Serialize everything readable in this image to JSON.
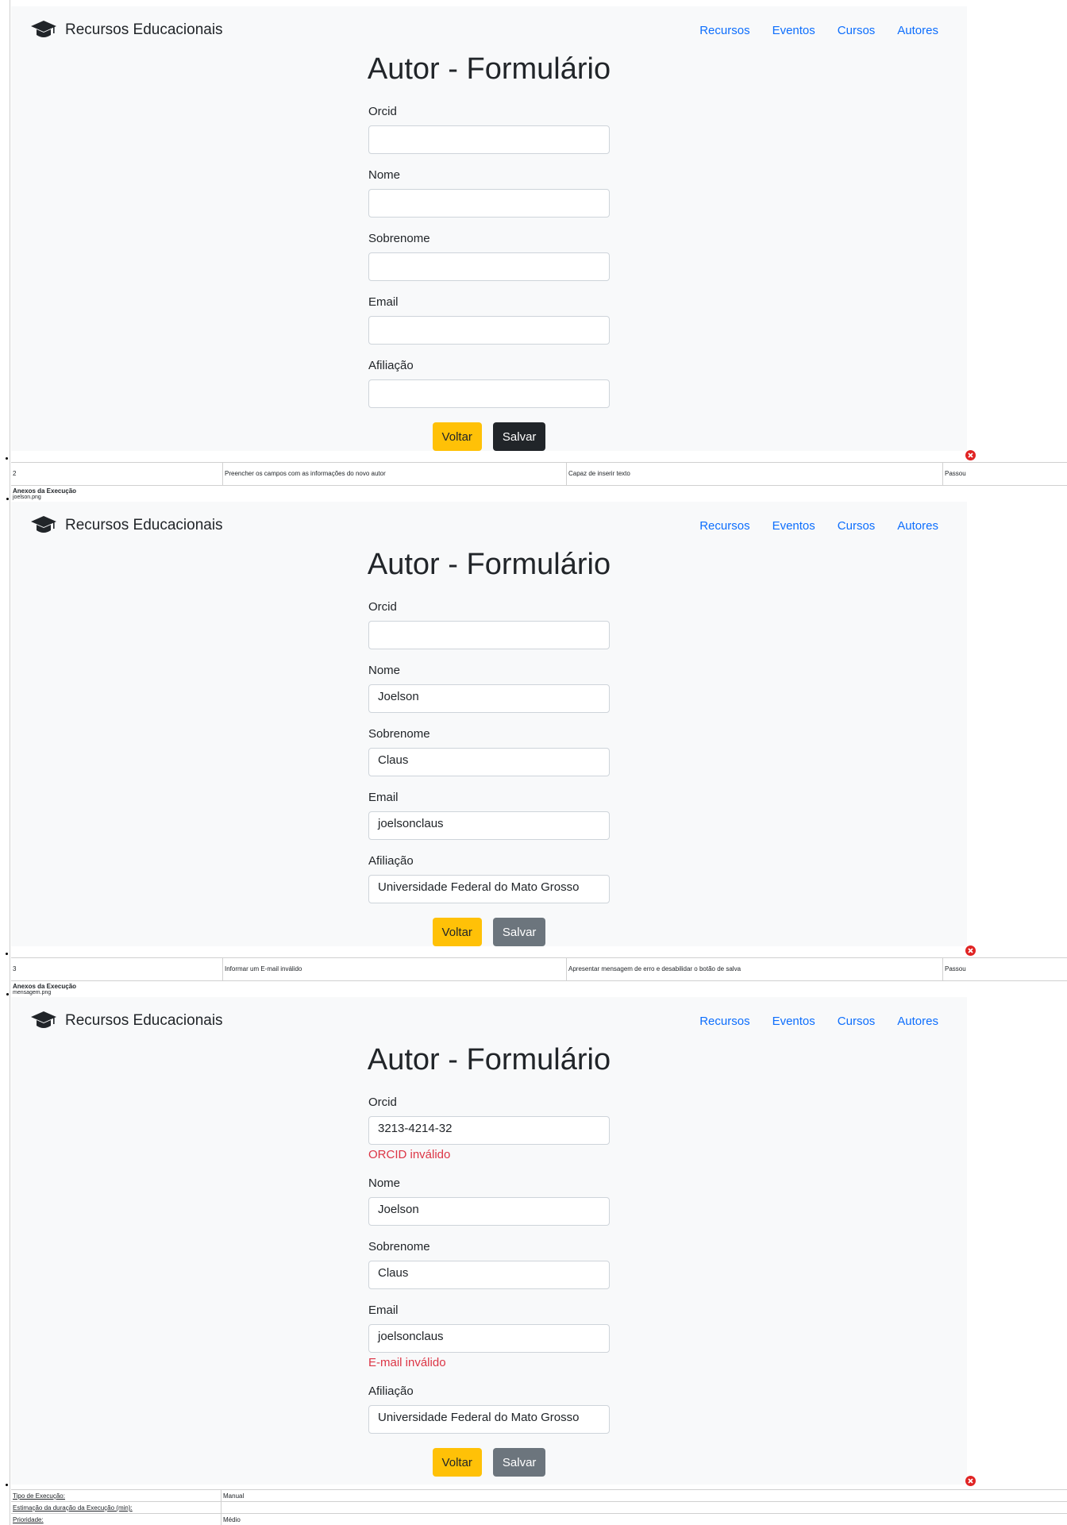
{
  "brand": {
    "name": "Recursos Educacionais",
    "icon": "graduation-cap-icon"
  },
  "nav": [
    {
      "label": "Recursos"
    },
    {
      "label": "Eventos"
    },
    {
      "label": "Cursos"
    },
    {
      "label": "Autores"
    }
  ],
  "labels": {
    "title": "Autor - Formulário",
    "orcid": "Orcid",
    "nome": "Nome",
    "sobrenome": "Sobrenome",
    "email": "Email",
    "afiliacao": "Afiliação",
    "voltar": "Voltar",
    "salvar": "Salvar"
  },
  "screens": [
    {
      "orcid": "",
      "nome": "",
      "sobrenome": "",
      "email": "",
      "afiliacao": ""
    },
    {
      "orcid": "",
      "nome": "Joelson",
      "sobrenome": "Claus",
      "email": "joelsonclaus",
      "afiliacao": "Universidade Federal do Mato Grosso"
    },
    {
      "orcid": "3213-4214-32",
      "orcid_error": "ORCID inválido",
      "nome": "Joelson",
      "sobrenome": "Claus",
      "email": "joelsonclaus",
      "email_error": "E-mail inválido",
      "afiliacao": "Universidade Federal do Mato Grosso"
    }
  ],
  "steps": [
    {
      "num": "2",
      "action": "Preencher os campos com as informações do novo autor",
      "expected": "Capaz de inserir texto",
      "status": "Passou"
    },
    {
      "num": "3",
      "action": "Informar um E-mail inválido",
      "expected": "Apresentar mensagem de erro e desabilidar o botão de salva",
      "status": "Passou"
    }
  ],
  "anexos": {
    "title": "Anexos da Execução",
    "files": [
      "joelson.png",
      "mensagem.png"
    ]
  },
  "meta": [
    {
      "key": "Tipo de Execução:",
      "value": "Manual"
    },
    {
      "key": "Estimação da duração da Execução (min):",
      "value": ""
    },
    {
      "key": "Prioridade:",
      "value": "Médio"
    }
  ],
  "colors": {
    "primary": "#0d6efd",
    "warning": "#ffc107",
    "dark": "#212529",
    "secondary": "#6c757d",
    "danger": "#dc3545",
    "panel": "#f8f9fa"
  }
}
